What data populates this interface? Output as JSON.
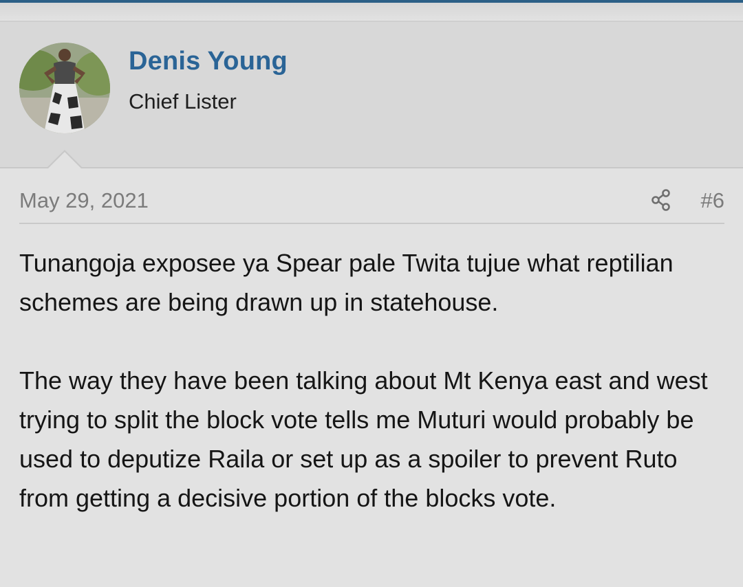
{
  "user": {
    "name": "Denis Young",
    "title": "Chief Lister",
    "avatar_icon": "user-avatar-photo"
  },
  "post": {
    "date": "May 29, 2021",
    "number": "#6",
    "share_icon": "share-icon",
    "paragraphs": [
      "Tunangoja exposee ya Spear pale Twita tujue what reptilian schemes are being drawn up in statehouse.",
      "The way they have been talking about Mt Kenya east and west trying to split the block vote tells me Muturi would probably be used to deputize Raila or set up as a spoiler to prevent Ruto from getting a decisive portion of the blocks vote."
    ]
  },
  "colors": {
    "accent": "#2a6496",
    "top_bar": "#2b5f86",
    "meta_text": "#7b7b7b",
    "body_text": "#151515",
    "background": "#e2e2e2",
    "user_block": "#d8d8d8"
  }
}
